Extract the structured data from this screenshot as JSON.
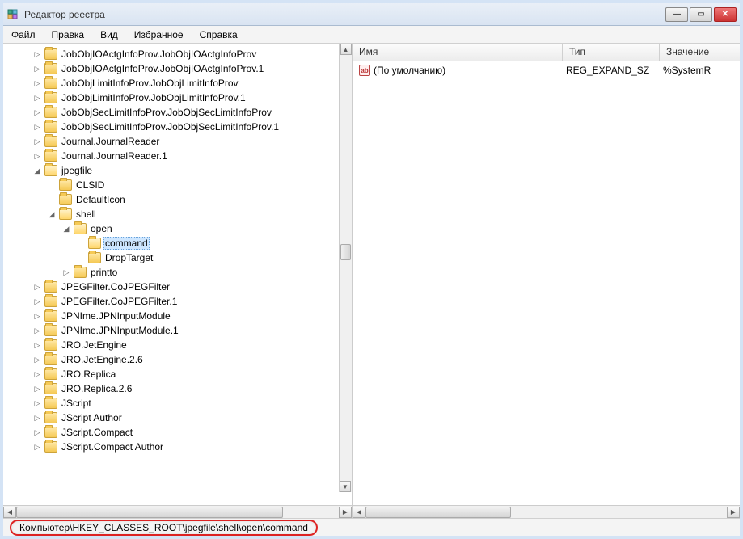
{
  "window": {
    "title": "Редактор реестра"
  },
  "menubar": {
    "file": "Файл",
    "edit": "Правка",
    "view": "Вид",
    "favorites": "Избранное",
    "help": "Справка"
  },
  "tree": {
    "nodes": [
      {
        "label": "JobObjIOActgInfoProv.JobObjIOActgInfoProv"
      },
      {
        "label": "JobObjIOActgInfoProv.JobObjIOActgInfoProv.1"
      },
      {
        "label": "JobObjLimitInfoProv.JobObjLimitInfoProv"
      },
      {
        "label": "JobObjLimitInfoProv.JobObjLimitInfoProv.1"
      },
      {
        "label": "JobObjSecLimitInfoProv.JobObjSecLimitInfoProv"
      },
      {
        "label": "JobObjSecLimitInfoProv.JobObjSecLimitInfoProv.1"
      },
      {
        "label": "Journal.JournalReader"
      },
      {
        "label": "Journal.JournalReader.1"
      },
      {
        "label": "jpegfile"
      },
      {
        "label": "CLSID"
      },
      {
        "label": "DefaultIcon"
      },
      {
        "label": "shell"
      },
      {
        "label": "open"
      },
      {
        "label": "command"
      },
      {
        "label": "DropTarget"
      },
      {
        "label": "printto"
      },
      {
        "label": "JPEGFilter.CoJPEGFilter"
      },
      {
        "label": "JPEGFilter.CoJPEGFilter.1"
      },
      {
        "label": "JPNIme.JPNInputModule"
      },
      {
        "label": "JPNIme.JPNInputModule.1"
      },
      {
        "label": "JRO.JetEngine"
      },
      {
        "label": "JRO.JetEngine.2.6"
      },
      {
        "label": "JRO.Replica"
      },
      {
        "label": "JRO.Replica.2.6"
      },
      {
        "label": "JScript"
      },
      {
        "label": "JScript Author"
      },
      {
        "label": "JScript.Compact"
      },
      {
        "label": "JScript.Compact Author"
      }
    ]
  },
  "list": {
    "headers": {
      "name": "Имя",
      "type": "Тип",
      "data": "Значение"
    },
    "rows": [
      {
        "name": "(По умолчанию)",
        "type": "REG_EXPAND_SZ",
        "data": "%SystemR"
      }
    ]
  },
  "statusbar": {
    "path": "Компьютер\\HKEY_CLASSES_ROOT\\jpegfile\\shell\\open\\command"
  }
}
